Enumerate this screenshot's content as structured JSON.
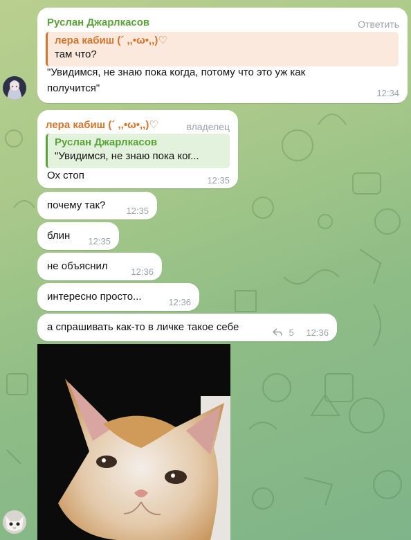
{
  "colors": {
    "green_name": "#5aa339",
    "orange_name": "#d5742a",
    "meta": "#9aa3a9"
  },
  "messages": [
    {
      "sender": "Руслан Джарлкасов",
      "action": "Ответить",
      "reply_to": {
        "name": "лера кабиш (´ ,,•ω•,,)♡",
        "text": "там что?"
      },
      "lines": [
        "\"Увидимся, не знаю пока когда, потому что это уж как",
        "получится\""
      ],
      "time": "12:34",
      "avatar_icon": "anime-avatar-icon"
    },
    {
      "sender": "лера кабиш (´ ,,•ω•,,)♡",
      "role": "владелец",
      "reply_to": {
        "name": "Руслан Джарлкасов",
        "text": "\"Увидимся, не знаю пока ког..."
      },
      "text": "Ох стоп",
      "time": "12:35"
    },
    {
      "text": "почему так?",
      "time": "12:35"
    },
    {
      "text": "блин",
      "time": "12:35"
    },
    {
      "text": "не объяснил",
      "time": "12:36"
    },
    {
      "text": "интересно просто...",
      "time": "12:36"
    },
    {
      "text": "а спрашивать как-то в личке такое себе",
      "time": "12:36",
      "reply_icon": "reply-arrow-icon",
      "reply_count": "5"
    }
  ],
  "photo": {
    "subject": "crying-kitten-photo",
    "avatar_icon": "cat-avatar-icon"
  }
}
